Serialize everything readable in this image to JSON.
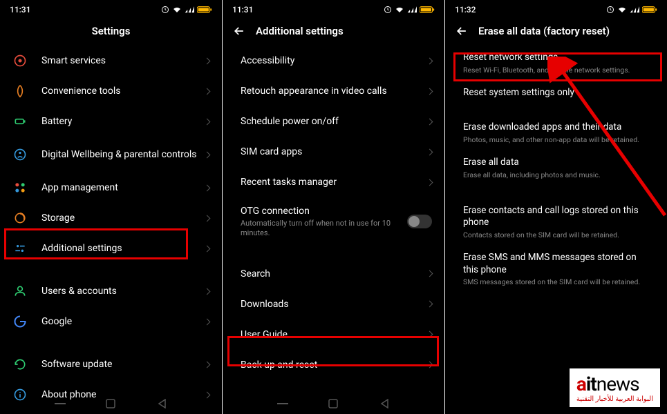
{
  "phone1": {
    "time": "11:31",
    "title": "Settings",
    "items": [
      {
        "icon": "smart",
        "label": "Smart services"
      },
      {
        "icon": "convenience",
        "label": "Convenience tools"
      },
      {
        "icon": "battery",
        "label": "Battery"
      },
      {
        "icon": "wellbeing",
        "label": "Digital Wellbeing & parental controls"
      },
      {
        "icon": "apps",
        "label": "App management"
      },
      {
        "icon": "storage",
        "label": "Storage"
      },
      {
        "icon": "additional",
        "label": "Additional settings",
        "highlighted": true
      },
      {
        "icon": "users",
        "label": "Users & accounts"
      },
      {
        "icon": "google",
        "label": "Google"
      },
      {
        "icon": "update",
        "label": "Software update"
      },
      {
        "icon": "about",
        "label": "About phone"
      }
    ]
  },
  "phone2": {
    "time": "11:31",
    "title": "Additional settings",
    "items": [
      {
        "label": "Accessibility"
      },
      {
        "label": "Retouch appearance in video calls"
      },
      {
        "label": "Schedule power on/off"
      },
      {
        "label": "SIM card apps"
      },
      {
        "label": "Recent tasks manager"
      },
      {
        "label": "OTG connection",
        "sublabel": "Automatically turn off when not in use for 10 minutes.",
        "toggle": true
      },
      {
        "label": "Search"
      },
      {
        "label": "Downloads"
      },
      {
        "label": "User Guide"
      },
      {
        "label": "Back up and reset",
        "highlighted": true
      }
    ]
  },
  "phone3": {
    "time": "11:32",
    "title": "Erase all data (factory reset)",
    "items": [
      {
        "label": "Reset network settings",
        "sublabel": "Reset Wi-Fi, Bluetooth, and mobile network settings.",
        "highlighted": true
      },
      {
        "label": "Reset system settings only"
      },
      {
        "label": "Erase downloaded apps and their data",
        "sublabel": "Photos, music, and other non-app data will be retained."
      },
      {
        "label": "Erase all data",
        "sublabel": "Erase all data, including photos and music."
      },
      {
        "label": "Erase contacts and call logs stored on this phone",
        "sublabel": "Contacts stored on the SIM card will be retained."
      },
      {
        "label": "Erase SMS and MMS messages stored on this phone",
        "sublabel": "SMS messages stored on the SIM card will be retained."
      }
    ]
  },
  "logo": {
    "brand": "aitnews",
    "tagline": "البوابة العربية للأخبار التقنية"
  }
}
